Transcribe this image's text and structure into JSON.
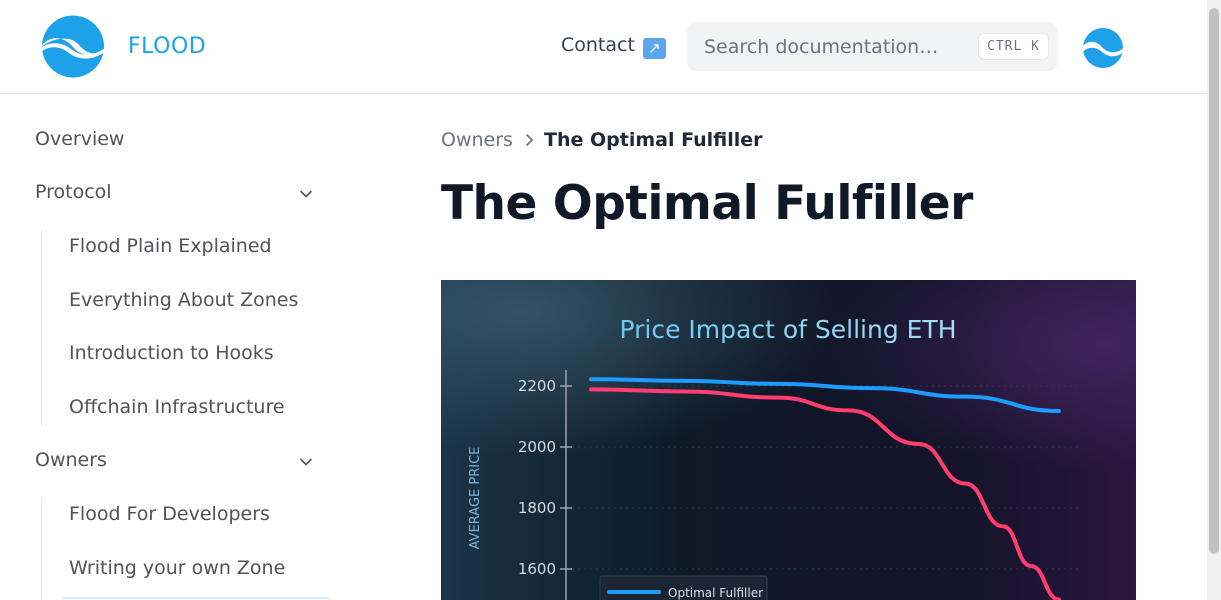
{
  "header": {
    "brand": "FLOOD",
    "contact_label": "Contact",
    "contact_icon": "north-east-arrow-icon",
    "search_placeholder": "Search documentation…",
    "search_shortcut": "CTRL K"
  },
  "sidebar": {
    "items": [
      {
        "label": "Overview"
      },
      {
        "label": "Protocol",
        "expanded": true,
        "children": [
          {
            "label": "Flood Plain Explained"
          },
          {
            "label": "Everything About Zones"
          },
          {
            "label": "Introduction to Hooks"
          },
          {
            "label": "Offchain Infrastructure"
          }
        ]
      },
      {
        "label": "Owners",
        "expanded": true,
        "children": [
          {
            "label": "Flood For Developers"
          },
          {
            "label": "Writing your own Zone"
          }
        ]
      }
    ]
  },
  "breadcrumb": {
    "parent": "Owners",
    "current": "The Optimal Fulfiller"
  },
  "page": {
    "title": "The Optimal Fulfiller"
  },
  "colors": {
    "brand": "#1da1e8",
    "optimal_line": "#1e9bff",
    "other_line": "#ff3d6e"
  },
  "chart_data": {
    "type": "line",
    "title": "Price Impact of Selling ETH",
    "ylabel": "AVERAGE PRICE",
    "yticks": [
      2200,
      2000,
      1800,
      1600
    ],
    "ylim": [
      1500,
      2260
    ],
    "xlim": [
      0,
      1
    ],
    "series": [
      {
        "name": "Optimal Fulfiller",
        "x": [
          0,
          0.2,
          0.4,
          0.6,
          0.8,
          1.0
        ],
        "values": [
          2222,
          2217,
          2207,
          2193,
          2165,
          2118
        ]
      },
      {
        "name": "",
        "x": [
          0,
          0.2,
          0.4,
          0.55,
          0.7,
          0.8,
          0.88,
          0.94,
          1.0
        ],
        "values": [
          2189,
          2182,
          2162,
          2120,
          2010,
          1880,
          1740,
          1610,
          1500
        ]
      }
    ],
    "legend": "bottom-left",
    "grid": true
  }
}
